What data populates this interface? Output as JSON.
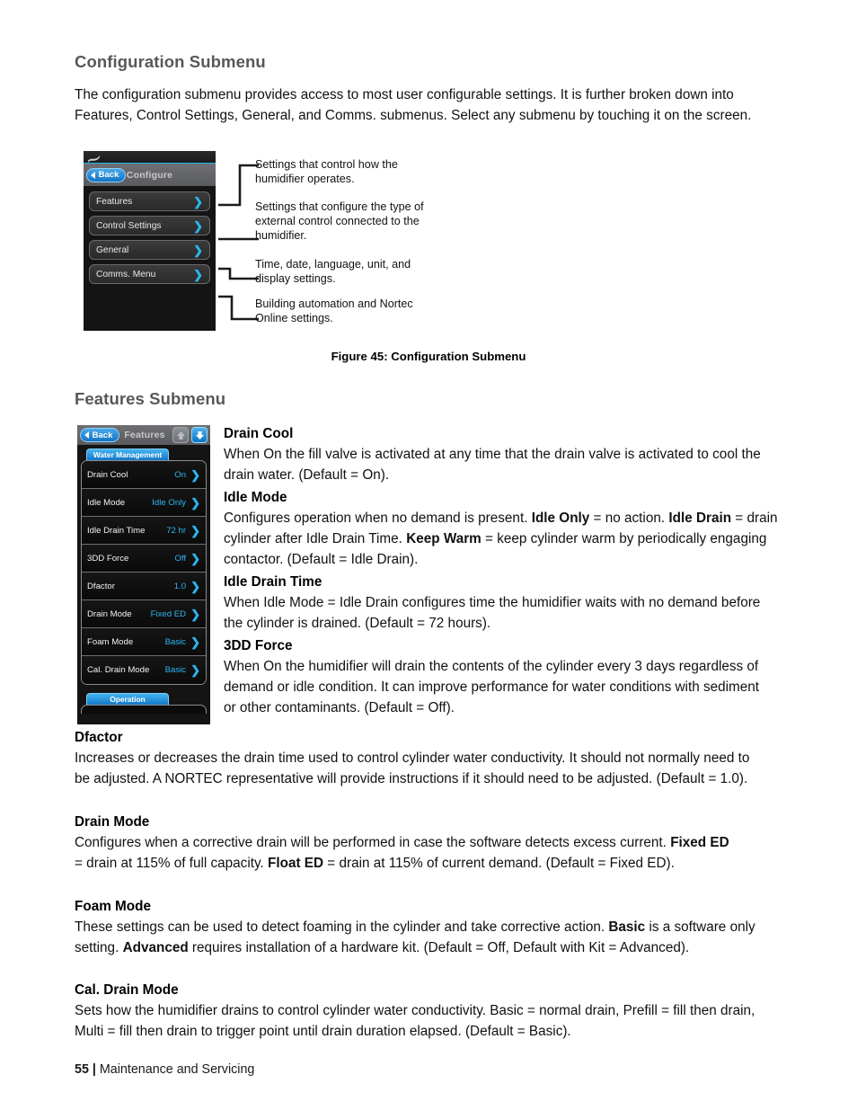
{
  "page": {
    "footer_page_number": "55",
    "footer_separator": "|",
    "footer_section": "Maintenance and Servicing"
  },
  "config_section": {
    "title": "Configuration Submenu",
    "intro": "The configuration submenu provides access to most user configurable settings.  It is further broken down into Features, Control Settings, General, and Comms. submenus. Select any submenu by touching it on the screen.",
    "figure_caption": "Figure 45: Configuration Submenu",
    "screen": {
      "logo_icon": "flag-logo-icon",
      "back_label": "Back",
      "title": "Configure",
      "buttons": [
        {
          "label": "Features",
          "icon": "chevron-right-icon"
        },
        {
          "label": "Control Settings",
          "icon": "chevron-right-icon"
        },
        {
          "label": "General",
          "icon": "chevron-right-icon"
        },
        {
          "label": "Comms. Menu",
          "icon": "chevron-right-icon"
        }
      ]
    },
    "callouts": [
      {
        "text": "Settings that control how the humidifier operates."
      },
      {
        "text": "Settings that configure the type of external control connected to the humidifier."
      },
      {
        "text": "Time, date, language, unit, and display settings."
      },
      {
        "text": "Building automation and Nortec Online settings."
      }
    ]
  },
  "features_section": {
    "title": "Features Submenu",
    "screen": {
      "back_label": "Back",
      "title": "Features",
      "up_icon": "arrow-up-icon",
      "down_icon": "arrow-down-icon",
      "tab_label": "Water Management",
      "section_label": "Operation",
      "rows": [
        {
          "label": "Drain Cool",
          "value": "On",
          "icon": "chevron-right-icon"
        },
        {
          "label": "Idle Mode",
          "value": "Idle Only",
          "icon": "chevron-right-icon"
        },
        {
          "label": "Idle Drain Time",
          "value": "72 hr",
          "icon": "chevron-right-icon"
        },
        {
          "label": "3DD Force",
          "value": "Off",
          "icon": "chevron-right-icon"
        },
        {
          "label": "Dfactor",
          "value": "1.0",
          "icon": "chevron-right-icon"
        },
        {
          "label": "Drain Mode",
          "value": "Fixed ED",
          "icon": "chevron-right-icon"
        },
        {
          "label": "Foam Mode",
          "value": "Basic",
          "icon": "chevron-right-icon"
        },
        {
          "label": "Cal. Drain Mode",
          "value": "Basic",
          "icon": "chevron-right-icon"
        }
      ]
    },
    "entries": {
      "drain_cool": {
        "heading": "Drain Cool",
        "body": "When On the fill valve is activated at any time that the drain valve is activated to cool the drain water.  (Default = On)."
      },
      "idle_mode": {
        "heading": "Idle Mode",
        "body_1": "Configures operation when no demand is present.  ",
        "bold_1": "Idle Only",
        "body_2": " = no action. ",
        "bold_2": "Idle Drain",
        "body_3": " = drain cylinder after Idle Drain Time.  ",
        "bold_3": "Keep Warm",
        "body_4": " = keep cylinder warm by periodically engaging contactor.  (Default = Idle Drain)."
      },
      "idle_drain_time": {
        "heading": "Idle Drain Time",
        "body": "When Idle Mode = Idle Drain configures time the humidifier waits with no demand before the cylinder is drained. (Default = 72 hours)."
      },
      "three_dd_force": {
        "heading": "3DD Force",
        "body": "When On the humidifier will drain the contents of the cylinder every 3 days regardless of demand or idle condition.  It can improve performance for water conditions with sediment or other contaminants. (Default = Off)."
      },
      "dfactor": {
        "heading": "Dfactor",
        "body": "Increases or decreases the drain time used to control cylinder water conductivity.  It should not normally need to be adjusted.  A NORTEC representative will provide instructions if it should need to be adjusted.  (Default = 1.0)."
      },
      "drain_mode": {
        "heading": "Drain Mode",
        "body_1": "Configures when a corrective drain will be performed in case the software detects excess current.  ",
        "bold_1": "Fixed ED",
        "body_2": " = drain at 115% of full capacity.  ",
        "bold_2": "Float ED",
        "body_3": " = drain at 115% of current demand.  (Default = Fixed ED)."
      },
      "foam_mode": {
        "heading": "Foam Mode",
        "body_1": "These settings can be used to detect foaming in the cylinder and take corrective action.  ",
        "bold_1": "Basic",
        "body_2": " is a software only setting.  ",
        "bold_2": "Advanced",
        "body_3": " requires installation of a hardware kit.  (Default =  Off, Default with Kit = Advanced)."
      },
      "cal_drain_mode": {
        "heading": "Cal. Drain Mode",
        "body": "Sets how the humidifier drains to control cylinder water conductivity.  Basic = normal drain, Prefill = fill then drain, Multi = fill then drain to trigger point until drain duration elapsed. (Default = Basic)."
      }
    }
  },
  "colors": {
    "accent_cyan": "#2cb6ef",
    "heading_gray": "#58585b",
    "device_bg": "#141414"
  }
}
